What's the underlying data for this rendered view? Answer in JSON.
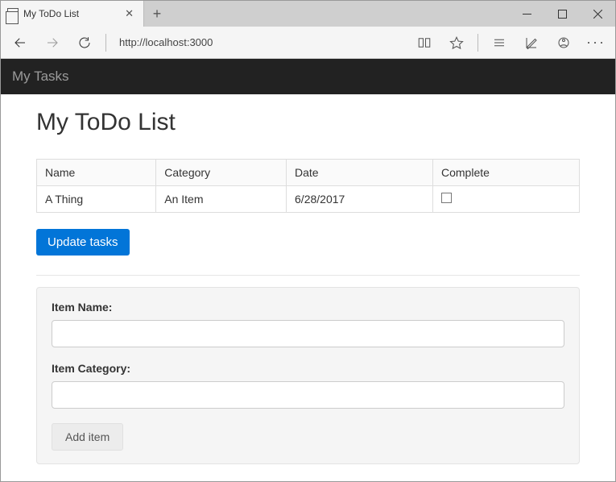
{
  "browser": {
    "tab_title": "My ToDo List",
    "url": "http://localhost:3000"
  },
  "navbar": {
    "brand": "My Tasks"
  },
  "page": {
    "title": "My ToDo List"
  },
  "table": {
    "headers": {
      "name": "Name",
      "category": "Category",
      "date": "Date",
      "complete": "Complete"
    },
    "rows": [
      {
        "name": "A Thing",
        "category": "An Item",
        "date": "6/28/2017",
        "complete": false
      }
    ]
  },
  "buttons": {
    "update": "Update tasks",
    "add": "Add item"
  },
  "form": {
    "name_label": "Item Name:",
    "category_label": "Item Category:"
  }
}
